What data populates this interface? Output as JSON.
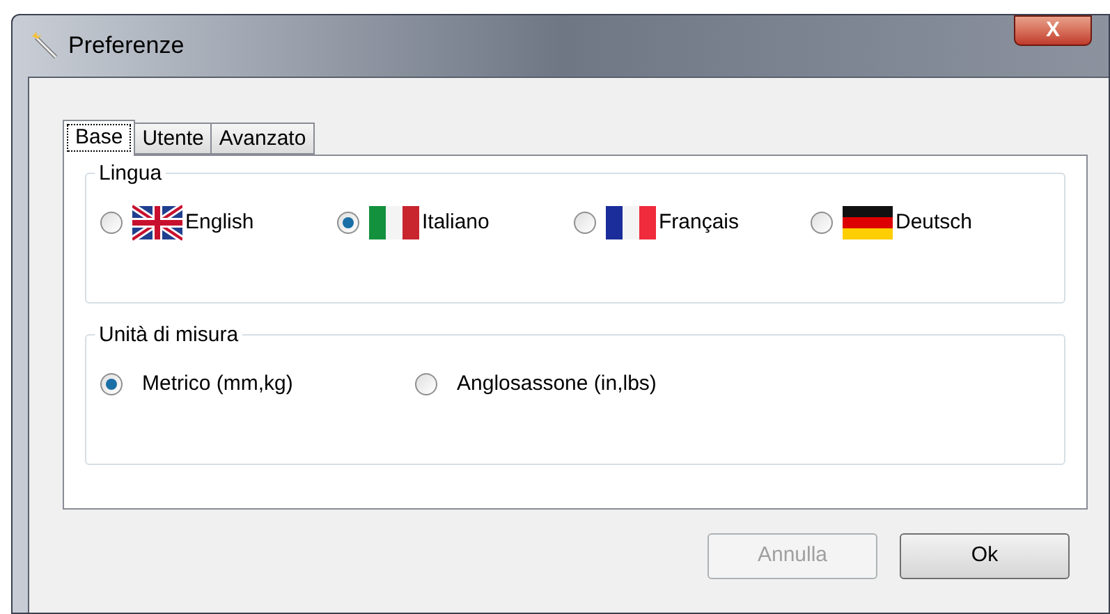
{
  "window": {
    "title": "Preferenze",
    "close": "X"
  },
  "tabs": [
    {
      "label": "Base",
      "selected": true
    },
    {
      "label": "Utente",
      "selected": false
    },
    {
      "label": "Avanzato",
      "selected": false
    }
  ],
  "groups": [
    {
      "title": "Lingua",
      "options": [
        {
          "label": "English",
          "kind": "uk",
          "selected": false
        },
        {
          "label": "Italiano",
          "kind": "it",
          "selected": true
        },
        {
          "label": "Français",
          "kind": "fr",
          "selected": false
        },
        {
          "label": "Deutsch",
          "kind": "de",
          "selected": false
        }
      ]
    },
    {
      "title": "Unità di misura",
      "options": [
        {
          "label": "Metrico (mm,kg)",
          "selected": true
        },
        {
          "label": "Anglosassone (in,lbs)",
          "selected": false
        }
      ]
    }
  ],
  "buttons": [
    {
      "label": "Annulla",
      "disabled": true
    },
    {
      "label": "Ok",
      "disabled": false
    }
  ]
}
